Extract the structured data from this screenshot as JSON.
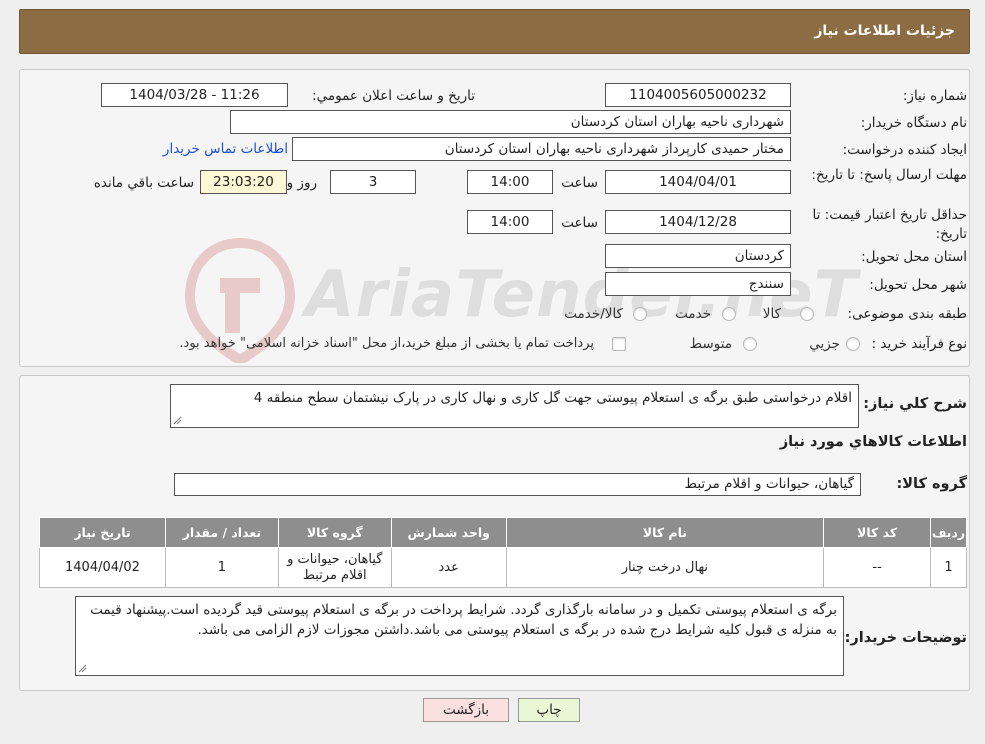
{
  "header": {
    "title": "جزئيات اطلاعات نياز"
  },
  "info": {
    "need_number_label": "شماره نياز:",
    "need_number": "1104005605000232",
    "announce_label": "تاريخ و ساعت اعلان عمومي:",
    "announce_value": "1404/03/28 - 11:26",
    "buyer_label": "نام دستگاه خريدار:",
    "buyer_value": "شهرداری ناحیه بهاران استان کردستان",
    "creator_label": "ايجاد کننده درخواست:",
    "creator_value": "مختار حمیدی کارپرداز شهرداری ناحیه بهاران استان کردستان",
    "contact_link": "اطلاعات تماس خريدار",
    "deadline_label": "مهلت ارسال پاسخ: تا تاريخ:",
    "deadline_date": "1404/04/01",
    "time_label": "ساعت",
    "deadline_time": "14:00",
    "days_value": "3",
    "days_label": "روز و",
    "remaining_time": "23:03:20",
    "remaining_label": "ساعت باقي مانده",
    "validity_label": "حداقل تاريخ اعتبار قيمت: تا تاريخ:",
    "validity_date": "1404/12/28",
    "validity_time": "14:00",
    "province_label": "استان محل تحويل:",
    "province_value": "کردستان",
    "city_label": "شهر محل تحويل:",
    "city_value": "سنندج",
    "category_label": "طبقه بندی موضوعی:",
    "category_options": [
      "کالا",
      "خدمت",
      "کالا/خدمت"
    ],
    "process_label": "نوع فرآيند خريد :",
    "process_options": [
      "جزيي",
      "متوسط"
    ],
    "process_note": "پرداخت تمام يا بخشی از مبلغ خريد،از محل \"اسناد خزانه اسلامی\" خواهد بود."
  },
  "watermark": {
    "text": "AriaTender.neT"
  },
  "summary": {
    "label": "شرح کلي نياز:",
    "value": "اقلام درخواستی طبق برگه ی استعلام پیوستی جهت گل کاری و نهال کاری در پارک نیشتمان سطح منطقه 4"
  },
  "goods": {
    "section_title": "اطلاعات کالاهاي مورد نياز",
    "group_label": "گروه کالا:",
    "group_value": "گیاهان، حیوانات و اقلام مرتبط"
  },
  "table": {
    "headers": [
      "رديف",
      "کد کالا",
      "نام کالا",
      "واحد شمارش",
      "گروه کالا",
      "تعداد / مقدار",
      "تاريخ نياز"
    ],
    "rows": [
      [
        "1",
        "--",
        "نهال درخت چنار",
        "عدد",
        "گیاهان، حیوانات و اقلام مرتبط",
        "1",
        "1404/04/02"
      ]
    ]
  },
  "buyer_notes": {
    "label": "توضيحات خريدار:",
    "value": "برگه ی استعلام پیوستی تکمیل و در سامانه بارگذاری گردد. شرایط  پرداخت در برگه ی استعلام پیوستی قید گردیده است.پیشنهاد قیمت به منزله ی قبول کلیه شرایط درج شده در برگه ی استعلام پیوستی می باشد.داشتن مجوزات لازم الزامی می باشد."
  },
  "buttons": {
    "print": "چاپ",
    "back": "بازگشت"
  },
  "colors": {
    "header": "#8c6d43",
    "print_button": "#eaf7d7",
    "back_button": "#fbe0e0",
    "link": "#1a4fd6",
    "remaining_bg": "#fff8d6"
  }
}
